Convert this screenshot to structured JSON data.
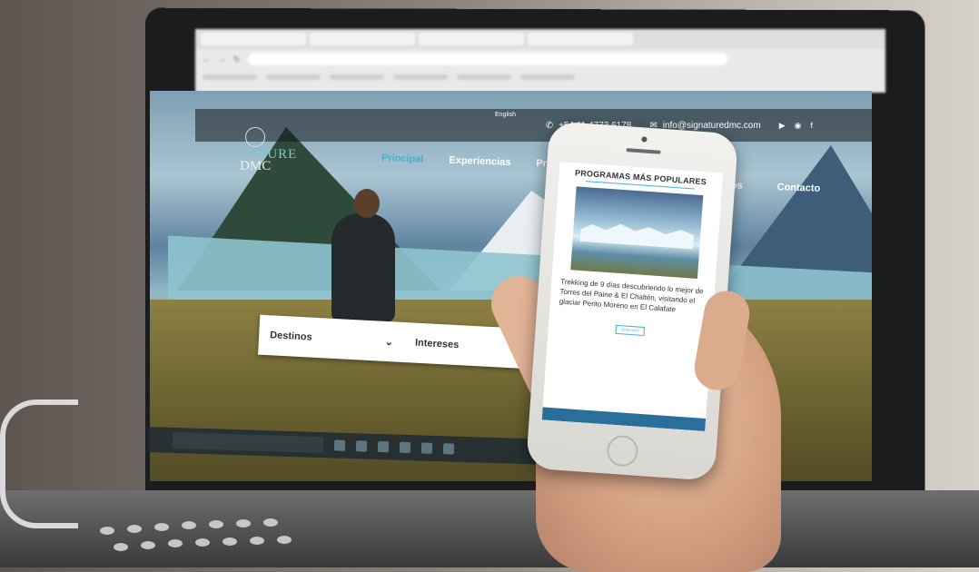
{
  "browser": {
    "tabs": [
      "",
      "",
      "",
      ""
    ],
    "url": ""
  },
  "site": {
    "top_bar": {
      "language": "English",
      "phone": "+54 11 4773 6178",
      "email": "info@signaturedmc.com",
      "social_icons": [
        "youtube-icon",
        "instagram-icon",
        "facebook-icon"
      ]
    },
    "logo": {
      "line1": "SIGNATURE",
      "line2": "DMC"
    },
    "nav": {
      "items": [
        "Principal",
        "Experiencias",
        "Programas"
      ],
      "items_right": [
        "mos",
        "Contacto"
      ],
      "active": "Principal"
    },
    "search": {
      "field1": "Destinos",
      "field2": "Intereses"
    }
  },
  "phone": {
    "section_title": "PROGRAMAS MÁS POPULARES",
    "card_heading": "Trekking de 9 días descubriendo lo mejor de Torres del Paine & El Chaltén, visitando el glaciar Perito Moreno en El Calafate",
    "card_body": "",
    "card_button": "LEER MÁS"
  },
  "colors": {
    "accent": "#3fb2cf",
    "logo_teal": "#7ec7d3",
    "phone_footer": "#2a6f9a"
  }
}
